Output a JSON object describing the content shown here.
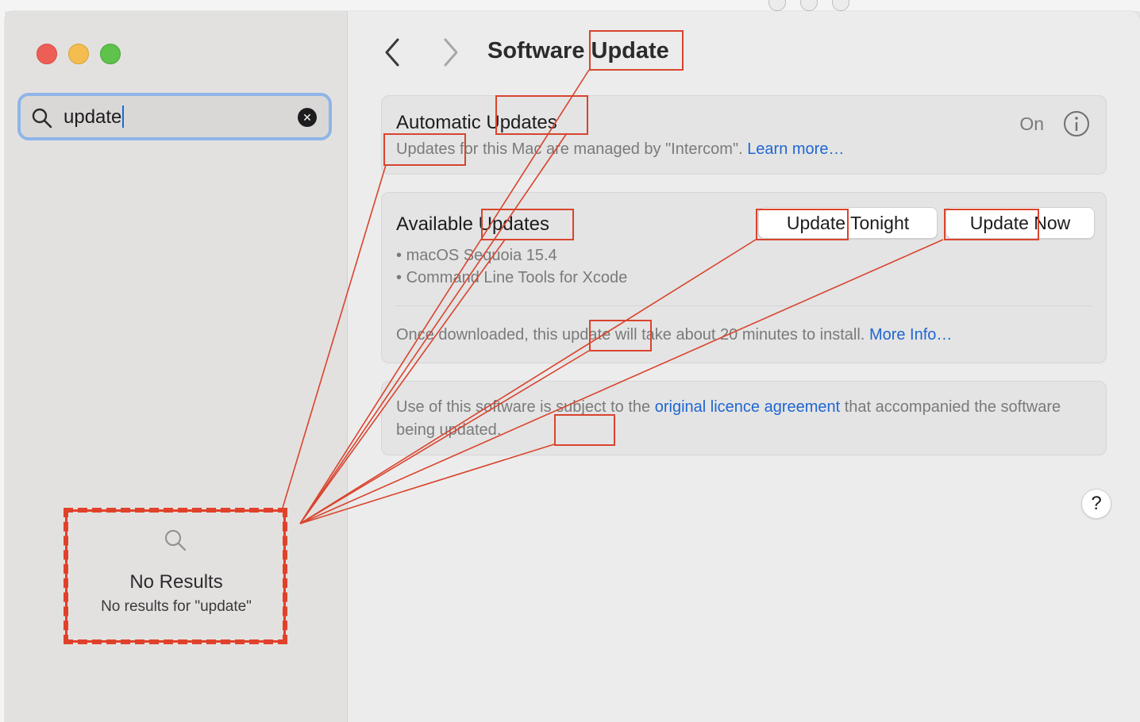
{
  "window": {
    "title": "Software Update",
    "traffic_lights": [
      "close",
      "minimize",
      "zoom"
    ]
  },
  "sidebar": {
    "search": {
      "value": "update",
      "icon": "search-icon",
      "clear_icon": "clear-icon"
    },
    "no_results": {
      "title": "No Results",
      "subtitle": "No results for \"update\""
    }
  },
  "toolbar": {
    "back_icon": "chevron-left-icon",
    "forward_icon": "chevron-right-icon"
  },
  "automatic_updates": {
    "title": "Automatic Updates",
    "description": "Updates for this Mac are managed by \"Intercom\".",
    "link": "Learn more…",
    "status": "On"
  },
  "available_updates": {
    "title": "Available Updates",
    "items": [
      "macOS Sequoia 15.4",
      "Command Line Tools for Xcode"
    ],
    "buttons": {
      "update_tonight": "Update Tonight",
      "update_now": "Update Now"
    },
    "note": "Once downloaded, this update will take about 20 minutes to install.",
    "more_info": "More Info…"
  },
  "licence": {
    "text_before": "Use of this software is subject to the",
    "link": "original licence agreement",
    "text_after": "that accompanied the software being updated."
  },
  "help": {
    "label": "?"
  },
  "annotation": {
    "color": "#d9442e"
  }
}
